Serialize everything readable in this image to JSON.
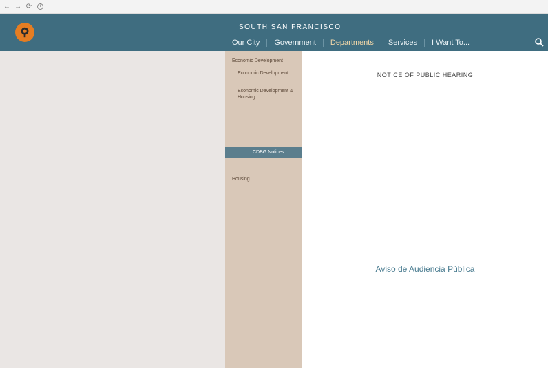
{
  "browser": {
    "back": "←",
    "forward": "→",
    "reload": "⟳",
    "url_prefix": "",
    "url_domain": "",
    "url_rest": ""
  },
  "site": {
    "kicker": "",
    "title": "SOUTH SAN FRANCISCO",
    "nav": [
      "Our City",
      "Government",
      "Departments",
      "Services",
      "I Want To..."
    ],
    "active_nav": 2
  },
  "sidebar": {
    "items": [
      {
        "label": "Economic Development"
      },
      {
        "label": "Economic Development"
      },
      {
        "label": "Economic Development & Housing"
      },
      {
        "label": ""
      },
      {
        "label": ""
      },
      {
        "label": ""
      },
      {
        "label": "Housing"
      },
      {
        "label": ""
      },
      {
        "label": ""
      }
    ],
    "active_label": "CDBG Notices"
  },
  "content": {
    "notice_title": "NOTICE OF PUBLIC HEARING",
    "notice_sub1": "",
    "notice_sub2": "",
    "notice_sub3": "",
    "notice_sub4": "",
    "notice_sub5": "",
    "para1": "",
    "para2": "",
    "contact_lines": [
      "",
      "",
      ""
    ],
    "para3": "",
    "plan_heading": "",
    "para4": "",
    "spanish_title": "Aviso de Audiencia Pública",
    "spanish_lines": [
      "",
      "",
      "",
      ""
    ],
    "para5": ""
  },
  "colors": {
    "header": "#3f6d80",
    "logo": "#e57d22",
    "sidebar": "#d9c8b8",
    "sidebar_active": "#5b7e8d",
    "left_panel": "#eae6e4"
  }
}
